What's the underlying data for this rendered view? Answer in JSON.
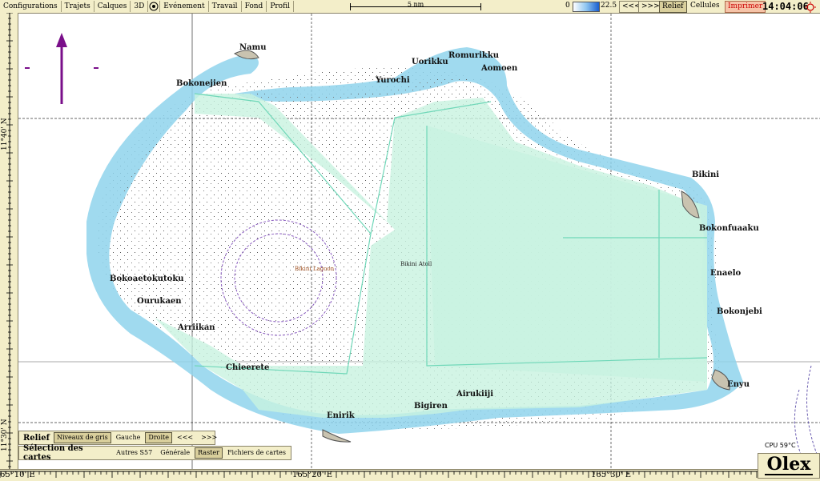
{
  "menu": {
    "items": [
      "Configurations",
      "Trajets",
      "Calques",
      "3D",
      "Evénement",
      "Travail",
      "Fond",
      "Profil"
    ]
  },
  "scale": {
    "label": "5 nm"
  },
  "depth": {
    "min": "0",
    "max": "22.5"
  },
  "nav": {
    "back": "<<<",
    "forward": ">>>"
  },
  "toggles": {
    "relief": "Relief",
    "cellules": "Cellules",
    "imprimer": "Imprimer"
  },
  "clock": "14:04:06",
  "lat_labels": [
    "11°40' N",
    "11°30' N"
  ],
  "lon_labels": [
    "65°10' E",
    "165°20' E",
    "165°30' E"
  ],
  "places": {
    "namu": "Namu",
    "bokonejien": "Bokonejien",
    "uorikku": "Uorikku",
    "romurikku": "Romurikku",
    "aomoen": "Aomoen",
    "yurochi": "Yurochi",
    "bikini": "Bikini",
    "bokonfuaaku": "Bokonfuaaku",
    "enaelo": "Enaelo",
    "bokonjebi": "Bokonjebi",
    "enyu": "Enyu",
    "airukiiji": "Airukiiji",
    "bigiren": "Bigiren",
    "enirik": "Enirik",
    "chieerete": "Chieerete",
    "arriikan": "Arriikan",
    "ourukaen": "Ourukaen",
    "bokoaetokutoku": "Bokoaetokutoku",
    "lagoon": "Bikini Lagoon",
    "atoll": "Bikini Atoll"
  },
  "relief_panel": {
    "title": "Relief",
    "buttons": [
      "Niveaux de gris",
      "Gauche",
      "Droite",
      "<<<",
      ">>>"
    ]
  },
  "charts_panel": {
    "title": "Sélection des cartes",
    "buttons": [
      "Autres S57",
      "Générale",
      "Raster",
      "Fichiers de cartes"
    ]
  },
  "cpu": "CPU 59°C",
  "logo": "Olex",
  "colors": {
    "panel_bg": "#f3eec9",
    "reef": "#8fd3ec",
    "shallow": "#c8f2e0",
    "route": "#6fd7b8",
    "north_arrow": "#7a0f8a",
    "imprimer": "#cc0000"
  }
}
